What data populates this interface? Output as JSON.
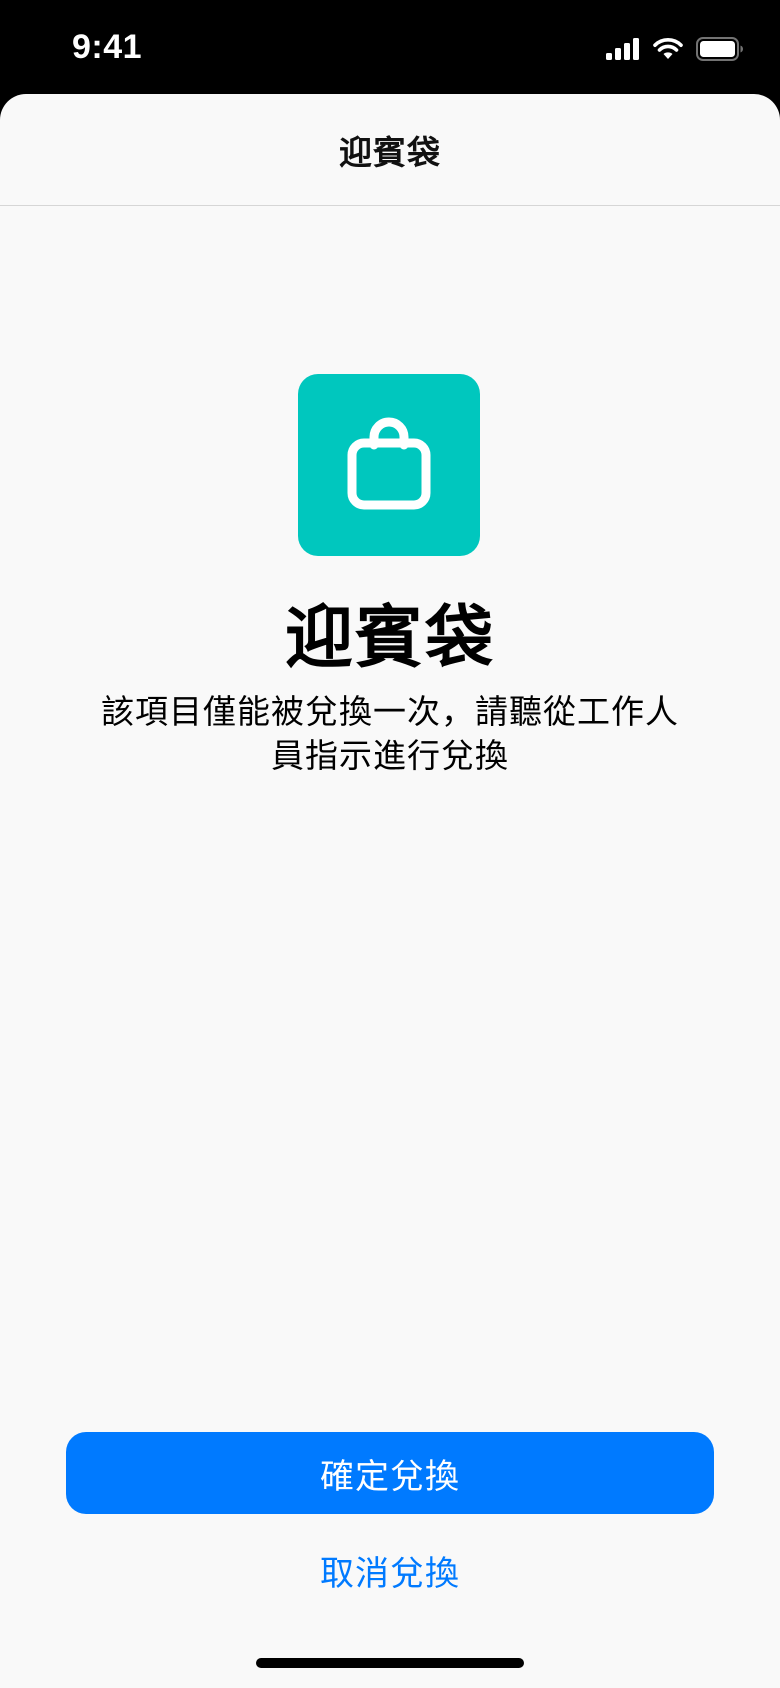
{
  "status_bar": {
    "time": "9:41",
    "icons": [
      "cellular-signal-icon",
      "wifi-icon",
      "battery-icon"
    ]
  },
  "nav": {
    "title": "迎賓袋"
  },
  "item": {
    "icon": "shopping-bag-icon",
    "icon_background": "#00c7be",
    "title": "迎賓袋",
    "description": "該項目僅能被兌換一次，請聽從工作人員指示進行兌換"
  },
  "actions": {
    "confirm_label": "確定兌換",
    "cancel_label": "取消兌換",
    "accent_color": "#007aff"
  }
}
